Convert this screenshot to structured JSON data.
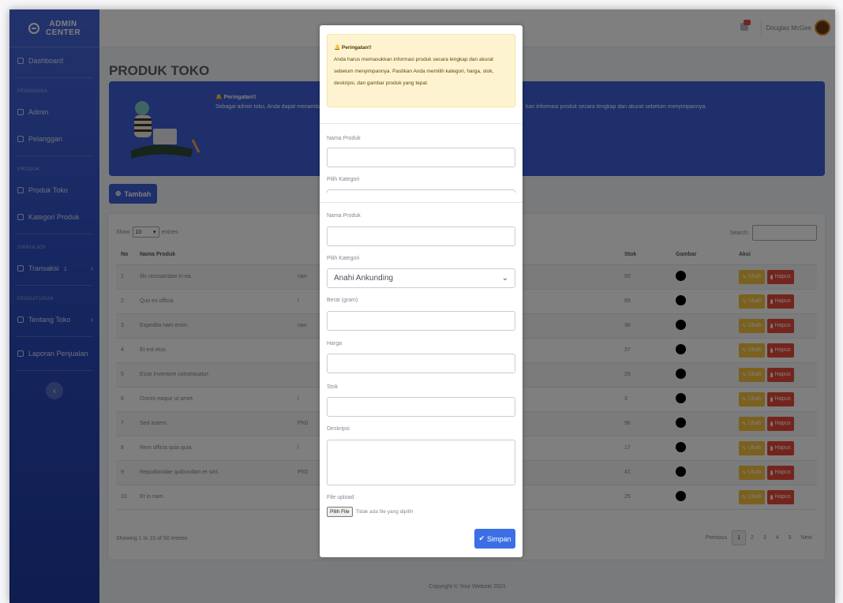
{
  "app": {
    "brand": "ADMIN CENTER",
    "brand_line1": "ADMIN",
    "brand_line2": "CENTER"
  },
  "topbar": {
    "user_name": "Douglas McGee",
    "alert_badge": "1"
  },
  "sidebar": {
    "dashboard": "Dashboard",
    "head_pengguna": "PENGGUNA",
    "admin": "Admin",
    "pelanggan": "Pelanggan",
    "head_produk": "PRODUK",
    "produk_toko": "Produk Toko",
    "kategori_produk": "Kategori Produk",
    "head_sirkulasi": "SIRKULASI",
    "transaksi": "Transaksi",
    "transaksi_badge": "1",
    "head_pengaturan": "PENGATURAN",
    "tentang_toko": "Tentang Toko",
    "laporan": "Laporan Penjualan",
    "toggle_icon": "chevron-left-icon"
  },
  "page": {
    "title": "PRODUK TOKO",
    "banner_title": "Peringatan!!",
    "banner_text": "Sebagai admin toko, Anda dapat menambah",
    "banner_text_tail": "kan informasi produk secara lengkap dan akurat sebelum menyimpannya.",
    "add_button": "Tambah"
  },
  "table": {
    "show_label": "Show",
    "show_value": "10",
    "entries_label": "entries",
    "search_label": "Search:",
    "headers": {
      "no": "No",
      "nama": "Nama Produk",
      "stok": "Stok",
      "gambar": "Gambar",
      "aksi": "Aksi"
    },
    "rows": [
      {
        "no": "1",
        "nama": "Illo recusandae in ea.",
        "kat": "nan",
        "stok": "50"
      },
      {
        "no": "2",
        "nama": "Quo ex officia.",
        "kat": "l",
        "stok": "89"
      },
      {
        "no": "3",
        "nama": "Expedita nam enim.",
        "kat": "nan",
        "stok": "38"
      },
      {
        "no": "4",
        "nama": "Et est eius.",
        "kat": "",
        "stok": "37"
      },
      {
        "no": "5",
        "nama": "Esse inventore consequatur.",
        "kat": "",
        "stok": "28"
      },
      {
        "no": "6",
        "nama": "Omnis eaque ut amet.",
        "kat": "l",
        "stok": "3"
      },
      {
        "no": "7",
        "nama": "Sed autem.",
        "kat": "PhD",
        "stok": "96"
      },
      {
        "no": "8",
        "nama": "Rem officia quia quia.",
        "kat": "l",
        "stok": "17"
      },
      {
        "no": "9",
        "nama": "Repudiandae quibusdam et sint.",
        "kat": "PhD",
        "stok": "41"
      },
      {
        "no": "10",
        "nama": "Et in nam.",
        "kat": "",
        "stok": "25"
      }
    ],
    "edit_label": "Ubah",
    "delete_label": "Hapus",
    "info": "Showing 1 to 10 of 50 entries",
    "pager": {
      "previous": "Previous",
      "pages": [
        "1",
        "2",
        "3",
        "4",
        "5"
      ],
      "next": "Next"
    }
  },
  "footer": "Copyright © Your Website 2021",
  "modal": {
    "alert_title": "Peringatan!!",
    "alert_text": "Anda harus memasukkan informasi produk secara lengkap dan akurat sebelum menyimpannya. Pastikan Anda memilih kategori, harga, stok, deskripsi, dan gambar produk yang tepat.",
    "nama_label_top": "Nama Produk",
    "kategori_label_top": "Pilih Kategori",
    "nama_label": "Nama Produk",
    "kategori_label": "Pilih Kategori",
    "kategori_value": "Anahi Ankunding",
    "berat_label": "Berat (gram)",
    "harga_label": "Harga",
    "stok_label": "Stok",
    "deskripsi_label": "Deskripsi",
    "file_label": "File upload",
    "file_button": "Pilih File",
    "file_status": "Tidak ada file yang dipilih",
    "save_button": "Simpan"
  },
  "colors": {
    "primary": "#3c5ed6",
    "warning": "#f6c23e",
    "danger": "#e74a3b",
    "alert_bg": "#fdf3d0"
  }
}
